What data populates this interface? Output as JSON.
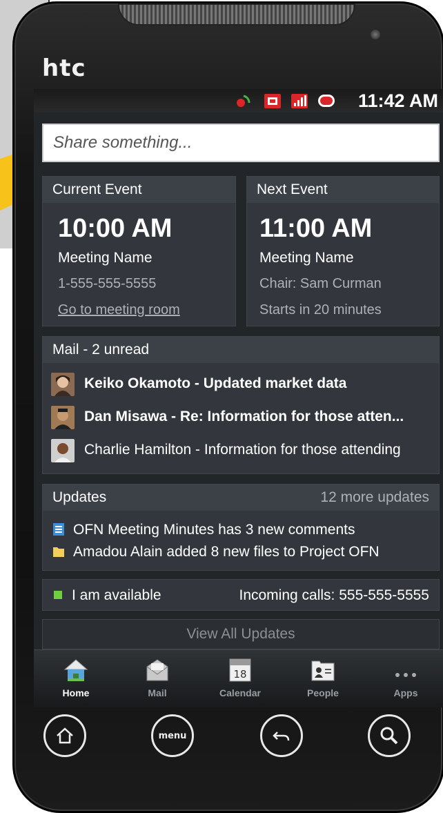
{
  "device": {
    "brand": "htc"
  },
  "status_bar": {
    "time": "11:42 AM"
  },
  "share": {
    "placeholder": "Share something..."
  },
  "current_event": {
    "header": "Current Event",
    "time": "10:00 AM",
    "name": "Meeting Name",
    "phone": "1-555-555-5555",
    "link": "Go to meeting room"
  },
  "next_event": {
    "header": "Next Event",
    "time": "11:00 AM",
    "name": "Meeting Name",
    "chair": "Chair: Sam Curman",
    "starts": "Starts in 20 minutes"
  },
  "mail": {
    "header": "Mail - 2 unread",
    "items": [
      {
        "text": "Keiko Okamoto - Updated market data",
        "unread": true
      },
      {
        "text": "Dan Misawa - Re: Information for those atten...",
        "unread": true
      },
      {
        "text": "Charlie Hamilton - Information for those attending",
        "unread": false
      }
    ]
  },
  "updates": {
    "header": "Updates",
    "more": "12 more updates",
    "items": [
      {
        "text": "OFN Meeting Minutes has 3 new comments",
        "icon": "document-icon"
      },
      {
        "text": "Amadou Alain added 8 new files to Project OFN",
        "icon": "folder-icon"
      }
    ]
  },
  "presence": {
    "status": "I am available",
    "status_color": "#6fcf3f",
    "incoming": "Incoming calls: 555-555-5555"
  },
  "view_all": "View All Updates",
  "calendar_day": "18",
  "tabs": [
    {
      "label": "Home",
      "icon": "home-icon",
      "active": true
    },
    {
      "label": "Mail",
      "icon": "mail-icon",
      "active": false
    },
    {
      "label": "Calendar",
      "icon": "calendar-icon",
      "active": false
    },
    {
      "label": "People",
      "icon": "people-icon",
      "active": false
    },
    {
      "label": "Apps",
      "icon": "apps-icon",
      "active": false
    }
  ],
  "hardware_buttons": {
    "menu_label": "menu"
  },
  "colors": {
    "accent_arrow": "#f7c21a",
    "screen_bg": "#222629",
    "card_bg": "#33373d"
  }
}
